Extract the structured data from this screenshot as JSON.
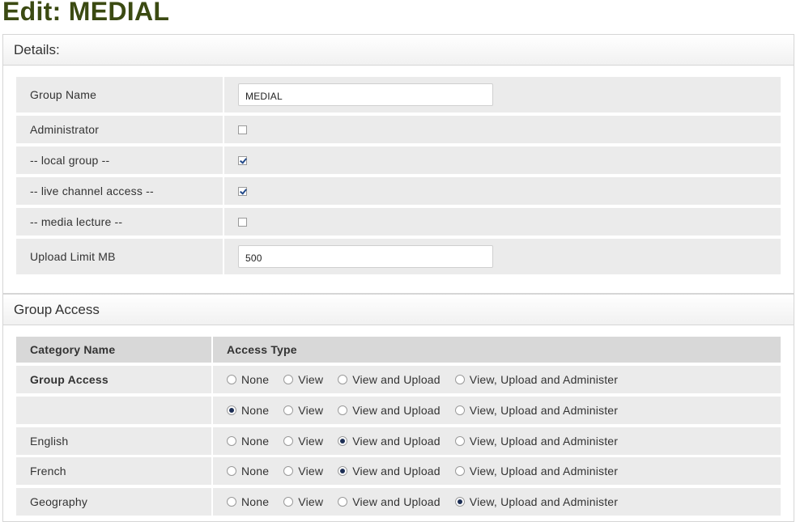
{
  "page": {
    "title": "Edit: MEDIAL"
  },
  "details": {
    "header": "Details:",
    "group_name": {
      "label": "Group Name",
      "value": "MEDIAL"
    },
    "administrator": {
      "label": "Administrator",
      "checked": false
    },
    "local_group": {
      "label": "-- local group --",
      "checked": true
    },
    "live_channel_access": {
      "label": "-- live channel access --",
      "checked": true
    },
    "media_lecture": {
      "label": "-- media lecture --",
      "checked": false
    },
    "upload_limit": {
      "label": "Upload Limit MB",
      "value": "500"
    }
  },
  "group_access": {
    "header": "Group Access",
    "columns": {
      "category": "Category Name",
      "access": "Access Type"
    },
    "options": [
      "None",
      "View",
      "View and Upload",
      "View, Upload and Administer"
    ],
    "rows": [
      {
        "category": "Group Access",
        "bold": true,
        "selected": null
      },
      {
        "category": "",
        "bold": false,
        "selected": "None"
      },
      {
        "category": "English",
        "bold": false,
        "selected": "View and Upload"
      },
      {
        "category": "French",
        "bold": false,
        "selected": "View and Upload"
      },
      {
        "category": "Geography",
        "bold": false,
        "selected": "View, Upload and Administer"
      }
    ]
  }
}
